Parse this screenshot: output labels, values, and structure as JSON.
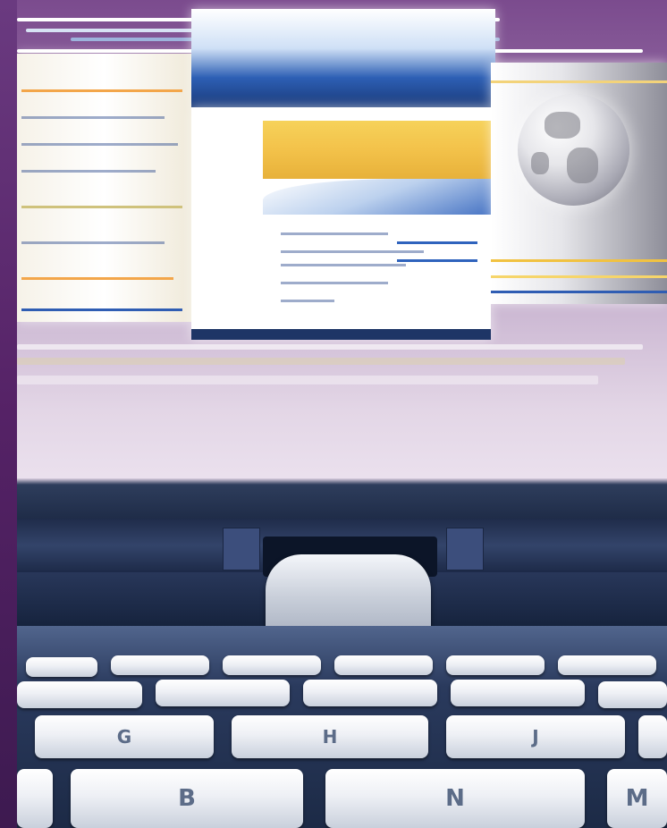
{
  "scene": {
    "description_icons": [
      "browser-windows-collage-icon",
      "globe-icon",
      "laptop-keyboard-icon"
    ],
    "colors": {
      "frame": "#5b2d72",
      "sky": "#c7b2cf",
      "keyboard_base": "#1c2a46",
      "key_face": "#eef0f5"
    }
  },
  "keyboard": {
    "keys": [
      "G",
      "H",
      "J",
      "B",
      "N",
      "M"
    ]
  }
}
